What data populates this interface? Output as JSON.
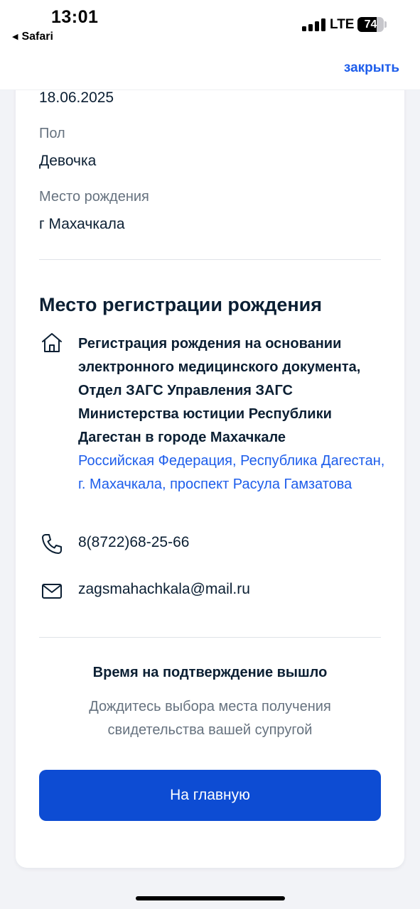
{
  "status_bar": {
    "time": "13:01",
    "back_app": "Safari",
    "network": "LTE",
    "battery_percent": "74",
    "battery_level": 0.74,
    "signal_bars": 4
  },
  "nav": {
    "close_label": "закрыть"
  },
  "details": {
    "birth_date": "18.06.2025",
    "gender_label": "Пол",
    "gender_value": "Девочка",
    "birthplace_label": "Место рождения",
    "birthplace_value": "г Махачкала"
  },
  "registration": {
    "title": "Место регистрации рождения",
    "office_name": "Регистрация рождения на основании электронного медицинского документа, Отдел ЗАГС Управления ЗАГС Министерства юстиции Республики Дагестан в городе Махачкале",
    "address": "Российская Федерация, Республика Дагестан, г. Махачкала, проспект Расула Гамзатова",
    "phone": "8(8722)68-25-66",
    "email": "zagsmahachkala@mail.ru",
    "icons": [
      "home-icon",
      "phone-icon",
      "mail-icon"
    ]
  },
  "notice": {
    "title": "Время на подтверждение вышло",
    "text": "Дождитесь выбора места получения свидетельства вашей супругой"
  },
  "actions": {
    "home_button": "На главную"
  },
  "colors": {
    "accent": "#0d4cd3",
    "link": "#1d5deb",
    "text": "#0b1f33",
    "muted": "#66727f",
    "background": "#f2f3f7"
  }
}
